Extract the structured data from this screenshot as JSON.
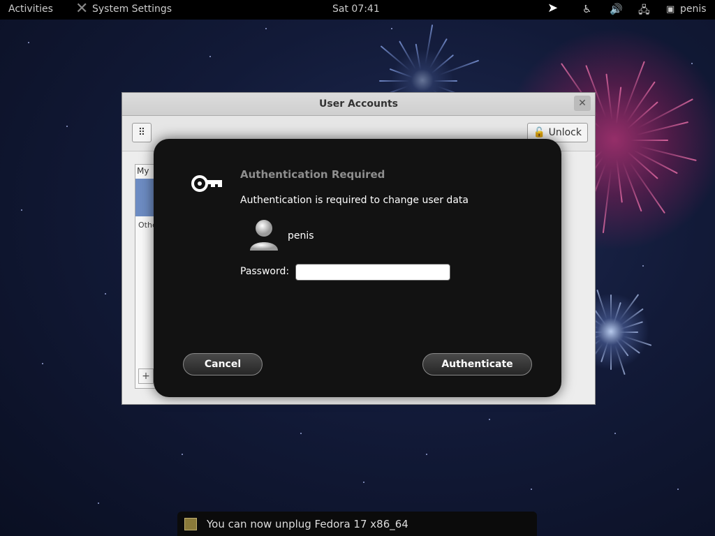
{
  "topbar": {
    "activities": "Activities",
    "app_title": "System Settings",
    "clock": "Sat 07:41",
    "user": "penis",
    "icons": [
      "accessibility-icon",
      "volume-icon",
      "network-icon",
      "user-icon"
    ]
  },
  "window": {
    "title": "User Accounts",
    "unlock_label": "Unlock",
    "sidebar_label": "My",
    "other_label": "Other"
  },
  "auth_dialog": {
    "heading": "Authentication Required",
    "description": "Authentication is required to change user data",
    "username": "penis",
    "password_label": "Password:",
    "password_value": "",
    "cancel_label": "Cancel",
    "authenticate_label": "Authenticate"
  },
  "notification": {
    "text": "You can now unplug Fedora 17 x86_64"
  },
  "colors": {
    "topbar": "#000000",
    "dialog_bg": "#121212",
    "heading": "#8e8e8e",
    "desktop": "#121a38",
    "firework_pink": "#e0307a",
    "firework_blue": "#a0b8ff"
  }
}
